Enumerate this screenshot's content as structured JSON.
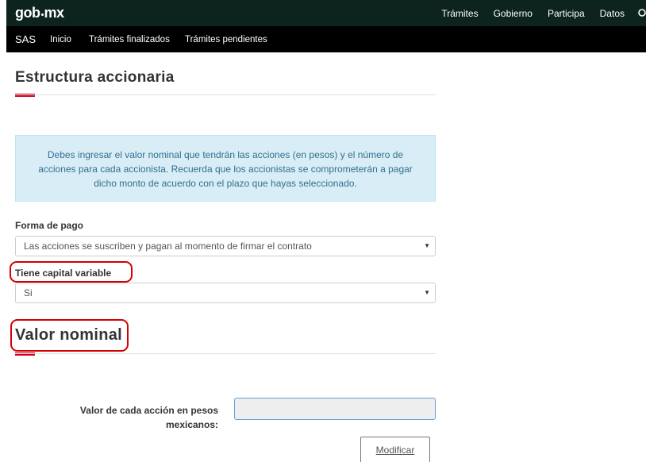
{
  "header": {
    "brand_left": "gob",
    "brand_right": "mx",
    "nav": [
      "Trámites",
      "Gobierno",
      "Participa",
      "Datos"
    ]
  },
  "subnav": {
    "app": "SAS",
    "items": [
      "Inicio",
      "Trámites finalizados",
      "Trámites pendientes"
    ]
  },
  "section1": {
    "title": "Estructura accionaria",
    "info": "Debes ingresar el valor nominal que tendrán las acciones (en pesos) y el número de acciones para cada accionista. Recuerda que los accionistas se comprometerán a pagar dicho monto de acuerdo con el plazo que hayas seleccionado."
  },
  "forma_pago": {
    "label": "Forma de pago",
    "selected": "Las acciones se suscriben y pagan al momento de firmar el contrato"
  },
  "capital_variable": {
    "label": "Tiene capital variable",
    "selected": "Si"
  },
  "section2": {
    "title": "Valor nominal"
  },
  "valor_accion": {
    "label": "Valor de cada acción en pesos mexicanos:",
    "value": ""
  },
  "buttons": {
    "modify": "Modificar"
  },
  "colors": {
    "topbar": "#0c231e",
    "subbar": "#000000",
    "accent_red": "#d0021b",
    "annotation": "#d40000",
    "info_bg": "#d9edf7",
    "info_text": "#31708f"
  }
}
